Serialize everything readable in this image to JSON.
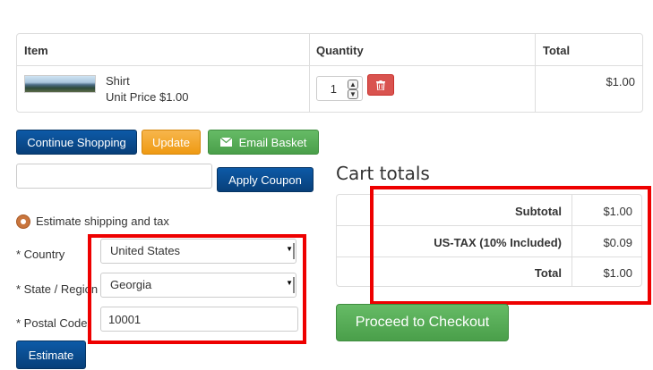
{
  "cart": {
    "headers": {
      "item": "Item",
      "quantity": "Quantity",
      "total": "Total"
    },
    "rows": [
      {
        "name": "Shirt",
        "unit_price": "Unit Price $1.00",
        "quantity": "1",
        "total": "$1.00"
      }
    ]
  },
  "actions": {
    "continue_shopping": "Continue Shopping",
    "update": "Update",
    "email_basket": "Email Basket"
  },
  "coupon": {
    "value": "",
    "apply_label": "Apply Coupon"
  },
  "shipping": {
    "heading": "Estimate shipping and tax",
    "country_label": "* Country",
    "country_value": "United States",
    "state_label": "* State / Region",
    "state_value": "Georgia",
    "postal_label": "* Postal Code",
    "postal_value": "10001",
    "estimate_label": "Estimate"
  },
  "totals": {
    "title": "Cart totals",
    "rows": [
      {
        "label": "Subtotal",
        "value": "$1.00"
      },
      {
        "label": "US-TAX (10% Included)",
        "value": "$0.09"
      },
      {
        "label": "Total",
        "value": "$1.00"
      }
    ],
    "checkout_label": "Proceed to Checkout"
  },
  "colors": {
    "highlight": "#ee0000",
    "primary": "#0a4a8f",
    "warning": "#f0a024",
    "success": "#52a852",
    "danger": "#d9534f"
  }
}
